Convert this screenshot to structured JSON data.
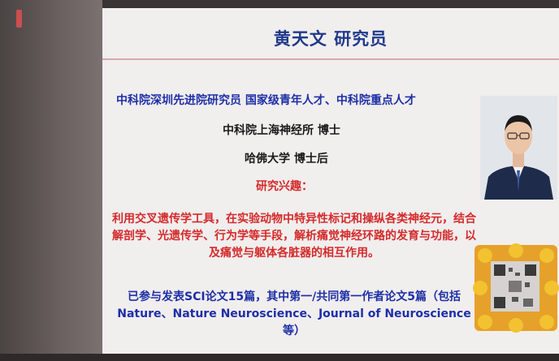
{
  "slide": {
    "title": "黄天文  研究员",
    "lines": [
      "中科院深圳先进院研究员  国家级青年人才、中科院重点人才",
      "中科院上海神经所  博士",
      "哈佛大学 博士后",
      "研究兴趣："
    ],
    "interest": "利用交叉遗传学工具，在实验动物中特异性标记和操纵各类神经元，结合解剖学、光遗传学、行为学等手段，解析痛觉神经环路的发育与功能，以及痛觉与躯体各脏器的相互作用。",
    "publications": "已参与发表SCI论文15篇，其中第一/共同第一作者论文5篇（包括Nature、Nature Neuroscience、Journal of Neuroscience等）"
  },
  "colors": {
    "title": "#1f3a8a",
    "blue_text": "#1e2fa6",
    "red_text": "#d42a2a",
    "slide_bg": "#f1eeee"
  }
}
